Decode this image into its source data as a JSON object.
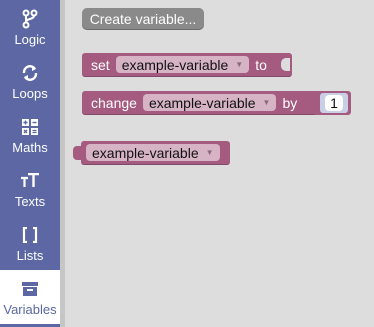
{
  "sidebar": {
    "items": [
      {
        "label": "Logic",
        "icon": "logic-icon"
      },
      {
        "label": "Loops",
        "icon": "loops-icon"
      },
      {
        "label": "Maths",
        "icon": "maths-icon"
      },
      {
        "label": "Texts",
        "icon": "texts-icon"
      },
      {
        "label": "Lists",
        "icon": "lists-icon"
      },
      {
        "label": "Variables",
        "icon": "variables-icon",
        "selected": true
      }
    ]
  },
  "flyout": {
    "create_button": "Create variable...",
    "set_block": {
      "keyword": "set",
      "variable": "example-variable",
      "suffix": "to"
    },
    "change_block": {
      "keyword": "change",
      "variable": "example-variable",
      "suffix": "by",
      "amount": "1"
    },
    "get_block": {
      "variable": "example-variable"
    }
  },
  "colors": {
    "sidebar": "#5c67a3",
    "variable_block": "#a55b80",
    "button": "#8a8a8a"
  }
}
